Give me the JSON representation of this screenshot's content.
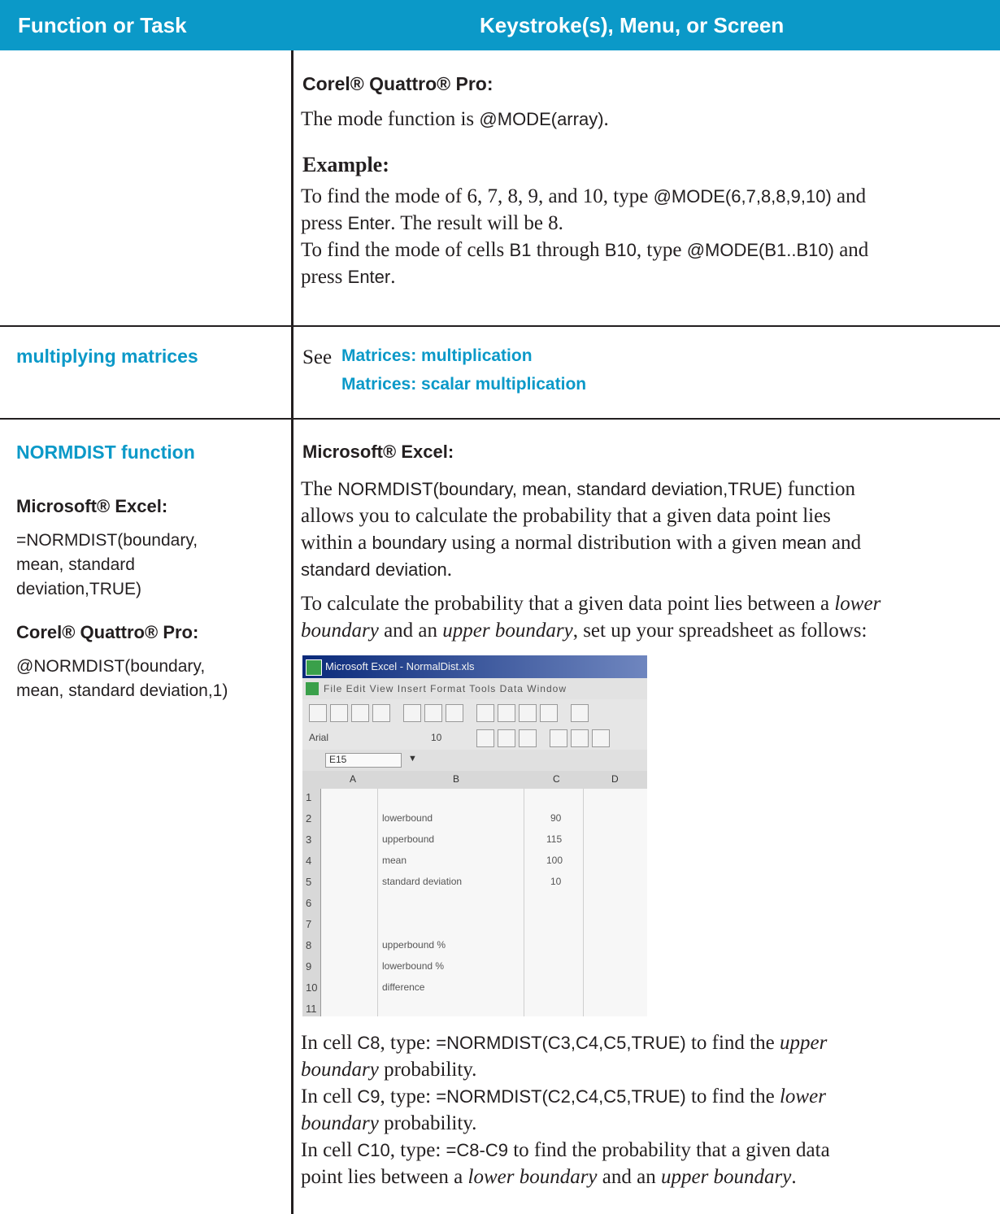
{
  "header": {
    "col1": "Function or Task",
    "col2": "Keystroke(s), Menu, or Screen"
  },
  "section1": {
    "heading": "Corel® Quattro® Pro:",
    "line1_a": "The mode function is ",
    "line1_code": "@MODE(array)",
    "line1_b": ".",
    "example_label": "Example:",
    "ex1_a": "To find the mode of 6, 7, 8, 9, and 10, type ",
    "ex1_code": "@MODE(6,7,8,8,9,10)",
    "ex1_b": " and",
    "ex2_a": "press ",
    "ex2_code": "Enter",
    "ex2_b": ". The result will be 8.",
    "ex3_a": "To find the mode of cells ",
    "ex3_code1": "B1",
    "ex3_mid": " through ",
    "ex3_code2": "B10",
    "ex3_c": ", type ",
    "ex3_code3": "@MODE(B1..B10)",
    "ex3_d": " and",
    "ex4_a": "press ",
    "ex4_code": "Enter",
    "ex4_b": "."
  },
  "section2": {
    "task": "multiplying matrices",
    "see": "See ",
    "link1": "Matrices: multiplication",
    "link2": "Matrices: scalar multiplication"
  },
  "section3": {
    "task": "NORMDIST function",
    "left_excel_label": "Microsoft® Excel:",
    "left_excel_line1": "=NORMDIST(boundary,",
    "left_excel_line2": "mean, standard",
    "left_excel_line3": "deviation,TRUE)",
    "left_quattro_label": "Corel® Quattro® Pro:",
    "left_quattro_line1": "@NORMDIST(boundary,",
    "left_quattro_line2": "mean, standard deviation,1)",
    "right_heading": "Microsoft® Excel:",
    "p1_a": "The ",
    "p1_code": "NORMDIST(boundary, mean, standard deviation,TRUE)",
    "p1_b": " function",
    "p2_a": "allows you to calculate the probability that a given data point lies",
    "p3_a": "within a ",
    "p3_code": "boundary",
    "p3_b": " using a normal distribution with a given ",
    "p3_code2": "mean",
    "p3_c": " and",
    "p4_code": "standard deviation",
    "p4_b": ".",
    "p5_a": "To calculate the probability that a given data point lies between a ",
    "p5_i": "lower",
    "p6_i1": "boundary",
    "p6_a": " and an ",
    "p6_i2": "upper boundary",
    "p6_b": ", set up your spreadsheet as follows:",
    "i1_a": "In cell ",
    "i1_c": "C8",
    "i1_b": ", type: ",
    "i1_code": "=NORMDIST(C3,C4,C5,TRUE)",
    "i1_d": " to find the ",
    "i1_i": "upper",
    "i2_i": "boundary",
    "i2_a": " probability.",
    "i3_a": "In cell ",
    "i3_c": "C9",
    "i3_b": ", type: ",
    "i3_code": "=NORMDIST(C2,C4,C5,TRUE)",
    "i3_d": " to find the ",
    "i3_i": "lower",
    "i4_i": "boundary",
    "i4_a": " probability.",
    "i5_a": "In cell ",
    "i5_c": "C10",
    "i5_b": ", type: ",
    "i5_code": "=C8-C9",
    "i5_d": " to find the probability that a given data",
    "i6_a": "point lies between a ",
    "i6_i1": "lower boundary",
    "i6_b": " and an ",
    "i6_i2": "upper boundary",
    "i6_c": "."
  },
  "screenshot": {
    "title": "Microsoft Excel - NormalDist.xls",
    "menu": "File  Edit  View  Insert  Format  Tools  Data  Window",
    "font": "Arial",
    "font_size": "10",
    "namebox": "E15",
    "col_a": "A",
    "col_b": "B",
    "col_c": "C",
    "col_d": "D",
    "rows": [
      "1",
      "2",
      "3",
      "4",
      "5",
      "6",
      "7",
      "8",
      "9",
      "10",
      "11"
    ],
    "labels": {
      "r2": "lowerbound",
      "r3": "upperbound",
      "r4": "mean",
      "r5": "standard deviation",
      "r8": "upperbound %",
      "r9": "lowerbound %",
      "r10": "difference"
    },
    "values": {
      "r2": "90",
      "r3": "115",
      "r4": "100",
      "r5": "10"
    }
  }
}
